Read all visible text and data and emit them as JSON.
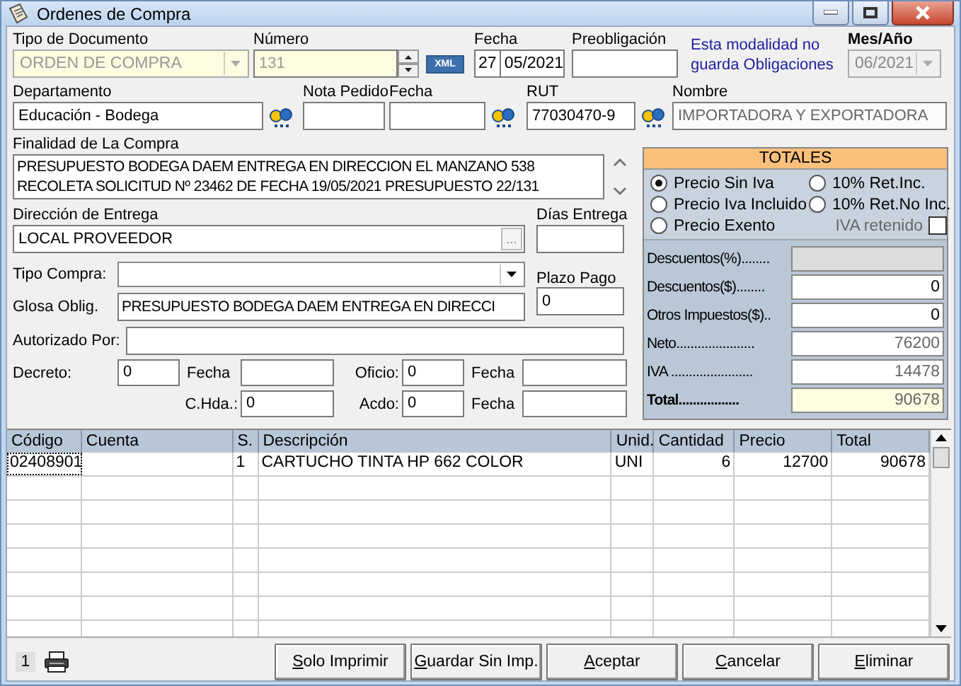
{
  "window": {
    "title": "Ordenes de Compra"
  },
  "header": {
    "tipo_documento": {
      "label": "Tipo de Documento",
      "value": "ORDEN DE COMPRA",
      "disabled": true
    },
    "numero": {
      "label": "Número",
      "value": "131",
      "disabled": true
    },
    "xml_button": "XML",
    "fecha": {
      "label": "Fecha",
      "day": "27",
      "month_year": "05/2021"
    },
    "preobligacion": {
      "label": "Preobligación"
    },
    "note": "Esta modalidad no guarda Obligaciones",
    "mes_ano": {
      "label": "Mes/Año",
      "value": "06/2021",
      "disabled": true
    }
  },
  "row2": {
    "departamento": {
      "label": "Departamento",
      "value": "Educación - Bodega"
    },
    "nota_pedido": {
      "label": "Nota Pedido"
    },
    "fecha": {
      "label": "Fecha"
    },
    "rut": {
      "label": "RUT",
      "value": "77030470-9"
    },
    "nombre": {
      "label": "Nombre",
      "value": "IMPORTADORA Y EXPORTADORA"
    }
  },
  "finalidad": {
    "label": "Finalidad de La Compra",
    "value": "PRESUPUESTO BODEGA DAEM ENTREGA EN DIRECCION EL MANZANO 538 RECOLETA SOLICITUD Nº 23462 DE FECHA 19/05/2021 PRESUPUESTO 22/131"
  },
  "direccion": {
    "label": "Dirección de Entrega",
    "value": "LOCAL PROVEEDOR",
    "button": "..."
  },
  "dias_entrega": {
    "label": "Días Entrega"
  },
  "tipo_compra": {
    "label": "Tipo Compra:"
  },
  "plazo_pago": {
    "label": "Plazo Pago",
    "value": "0"
  },
  "glosa": {
    "label": "Glosa Oblig.",
    "value": "PRESUPUESTO BODEGA DAEM ENTREGA EN DIRECCI"
  },
  "autorizado": {
    "label": "Autorizado Por:"
  },
  "decreto_row": [
    {
      "label": "Decreto:",
      "value": "0"
    },
    {
      "label": "Fecha"
    },
    {
      "label": "Oficio:",
      "value": "0"
    },
    {
      "label": "Fecha"
    }
  ],
  "chda_row": [
    {
      "label": "C.Hda.:",
      "value": "0"
    },
    {
      "label": "Acdo:",
      "value": "0"
    },
    {
      "label": "Fecha"
    }
  ],
  "totales": {
    "title": "TOTALES",
    "options": [
      {
        "label": "Precio Sin Iva",
        "selected": true
      },
      {
        "label": "10% Ret.Inc.",
        "selected": false
      },
      {
        "label": "Precio Iva Incluido",
        "selected": false
      },
      {
        "label": "10% Ret.No Inc.",
        "selected": false
      },
      {
        "label": "Precio Exento",
        "selected": false
      }
    ],
    "iva_retenido": {
      "label": "IVA retenido",
      "checked": false
    },
    "rows": [
      {
        "label": "Descuentos(%)........",
        "kind": "disabled"
      },
      {
        "label": "Descuentos($)........",
        "value": "0",
        "kind": "input"
      },
      {
        "label": "Otros Impuestos($)..",
        "value": "0",
        "kind": "input"
      },
      {
        "label": "Neto......................",
        "value": "76200",
        "kind": "readonly"
      },
      {
        "label": "IVA .......................",
        "value": "14478",
        "kind": "readonly"
      },
      {
        "label": "Total.................",
        "value": "90678",
        "kind": "total"
      }
    ]
  },
  "grid": {
    "columns": [
      "Código",
      "Cuenta",
      "S.",
      "Descripción",
      "Unid.",
      "Cantidad",
      "Precio",
      "Total"
    ],
    "rows": [
      [
        "02408901",
        "",
        "1",
        "CARTUCHO TINTA HP 662 COLOR",
        "UNI",
        "6",
        "12700",
        "90678"
      ]
    ]
  },
  "footer": {
    "page": "1",
    "buttons": [
      "Solo Imprimir",
      "Guardar Sin Imp.",
      "Aceptar",
      "Cancelar",
      "Eliminar"
    ]
  }
}
